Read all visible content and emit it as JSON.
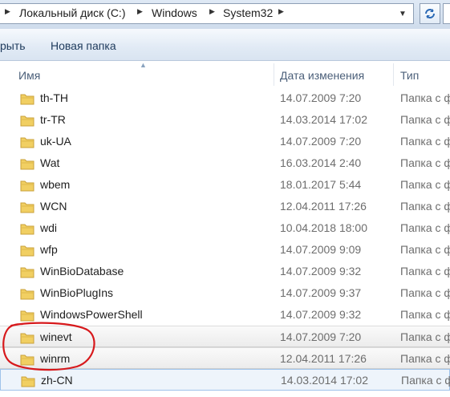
{
  "address": {
    "crumbs": [
      "Локальный диск (C:)",
      "Windows",
      "System32"
    ],
    "dropdown_icon": "chevron-down-icon",
    "refresh_icon": "refresh-icon"
  },
  "toolbar": {
    "cut_label": "рыть",
    "new_folder_label": "Новая папка"
  },
  "columns": {
    "name": "Имя",
    "date": "Дата изменения",
    "type": "Тип"
  },
  "rows": [
    {
      "name": "th-TH",
      "date": "14.07.2009 7:20",
      "type": "Папка с ф"
    },
    {
      "name": "tr-TR",
      "date": "14.03.2014 17:02",
      "type": "Папка с ф"
    },
    {
      "name": "uk-UA",
      "date": "14.07.2009 7:20",
      "type": "Папка с ф"
    },
    {
      "name": "Wat",
      "date": "16.03.2014 2:40",
      "type": "Папка с ф"
    },
    {
      "name": "wbem",
      "date": "18.01.2017 5:44",
      "type": "Папка с ф"
    },
    {
      "name": "WCN",
      "date": "12.04.2011 17:26",
      "type": "Папка с ф"
    },
    {
      "name": "wdi",
      "date": "10.04.2018 18:00",
      "type": "Папка с ф"
    },
    {
      "name": "wfp",
      "date": "14.07.2009 9:09",
      "type": "Папка с ф"
    },
    {
      "name": "WinBioDatabase",
      "date": "14.07.2009 9:32",
      "type": "Папка с ф"
    },
    {
      "name": "WinBioPlugIns",
      "date": "14.07.2009 9:37",
      "type": "Папка с ф"
    },
    {
      "name": "WindowsPowerShell",
      "date": "14.07.2009 9:32",
      "type": "Папка с ф"
    },
    {
      "name": "winevt",
      "date": "14.07.2009 7:20",
      "type": "Папка с ф"
    },
    {
      "name": "winrm",
      "date": "12.04.2011 17:26",
      "type": "Папка с ф"
    },
    {
      "name": "zh-CN",
      "date": "14.03.2014 17:02",
      "type": "Папка с ф"
    }
  ],
  "colors": {
    "annotation": "#d7191c",
    "folder": "#f1cf62"
  }
}
